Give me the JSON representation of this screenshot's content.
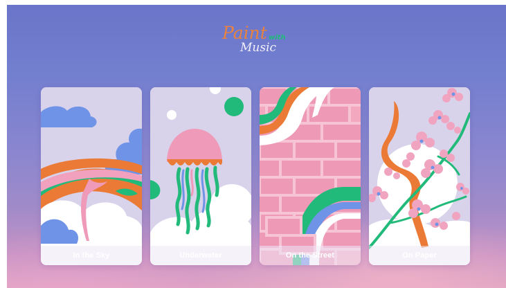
{
  "app": {
    "logo_line1": "Paint",
    "logo_line2": "with",
    "logo_line3": "Music"
  },
  "cards": [
    {
      "label": "In the Sky"
    },
    {
      "label": "Underwater"
    },
    {
      "label": "On the Street"
    },
    {
      "label": "On Paper"
    }
  ],
  "colors": {
    "orange": "#ea7a35",
    "green": "#22ba7a",
    "blue": "#6f93e6",
    "pink": "#ef9ab8",
    "card_bg": "#d9d2ea",
    "background_top": "#6a75c9",
    "background_bottom": "#dda1c4"
  }
}
